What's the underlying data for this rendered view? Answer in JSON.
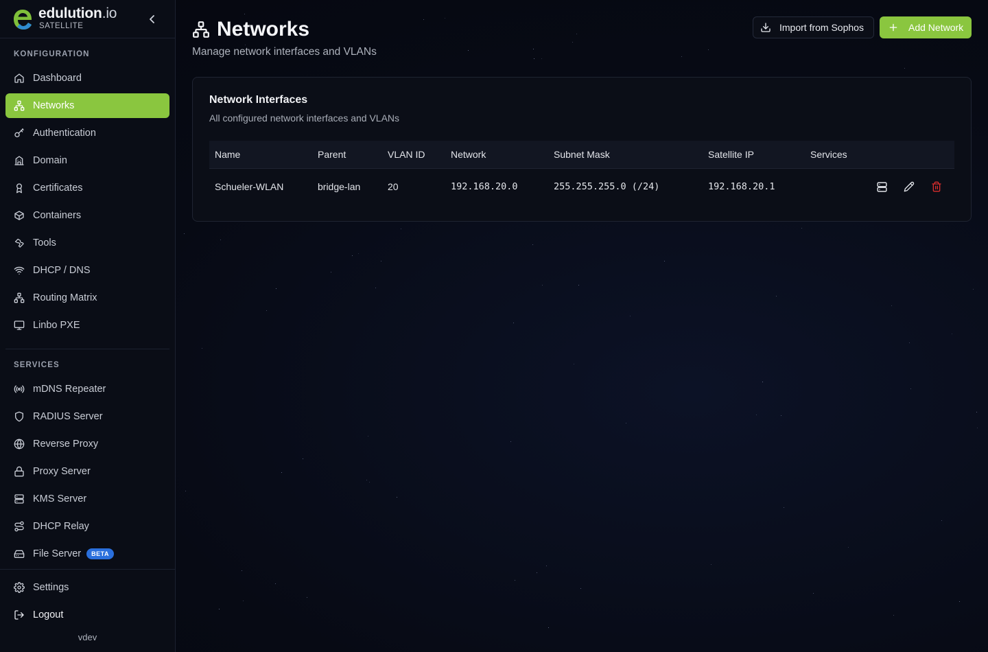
{
  "brand": {
    "name": "edulution",
    "name_suffix": ".io",
    "subtitle": "SATELLITE",
    "accent": "#8ac63f"
  },
  "sidebar": {
    "section_config": "KONFIGURATION",
    "config_items": [
      {
        "label": "Dashboard",
        "icon": "home-icon"
      },
      {
        "label": "Networks",
        "icon": "network-icon",
        "active": true
      },
      {
        "label": "Authentication",
        "icon": "key-icon"
      },
      {
        "label": "Domain",
        "icon": "building-icon"
      },
      {
        "label": "Certificates",
        "icon": "award-icon"
      },
      {
        "label": "Containers",
        "icon": "box-icon"
      },
      {
        "label": "Tools",
        "icon": "wrench-icon"
      },
      {
        "label": "DHCP / DNS",
        "icon": "wifi-icon"
      },
      {
        "label": "Routing Matrix",
        "icon": "network-icon"
      },
      {
        "label": "Linbo PXE",
        "icon": "monitor-icon"
      }
    ],
    "section_services": "SERVICES",
    "service_items": [
      {
        "label": "mDNS Repeater",
        "icon": "radio-icon"
      },
      {
        "label": "RADIUS Server",
        "icon": "shield-icon"
      },
      {
        "label": "Reverse Proxy",
        "icon": "globe-icon"
      },
      {
        "label": "Proxy Server",
        "icon": "lock-icon"
      },
      {
        "label": "KMS Server",
        "icon": "server-icon"
      },
      {
        "label": "DHCP Relay",
        "icon": "route-icon"
      },
      {
        "label": "File Server",
        "icon": "drive-icon",
        "badge": "BETA"
      }
    ],
    "settings_label": "Settings",
    "logout_label": "Logout",
    "version": "vdev"
  },
  "header": {
    "title": "Networks",
    "subtitle": "Manage network interfaces and VLANs",
    "import_label": "Import from Sophos",
    "add_label": "Add Network"
  },
  "card": {
    "title": "Network Interfaces",
    "description": "All configured network interfaces and VLANs",
    "columns": [
      "Name",
      "Parent",
      "VLAN ID",
      "Network",
      "Subnet Mask",
      "Satellite IP",
      "Services"
    ],
    "rows": [
      {
        "name": "Schueler-WLAN",
        "parent": "bridge-lan",
        "vlan_id": "20",
        "network": "192.168.20.0",
        "subnet_mask": "255.255.255.0 (/24)",
        "satellite_ip": "192.168.20.1",
        "services": ""
      }
    ]
  },
  "colors": {
    "delete": "#d92d2d",
    "active_nav": "#8ac63f",
    "beta_badge": "#2a6fdc"
  }
}
